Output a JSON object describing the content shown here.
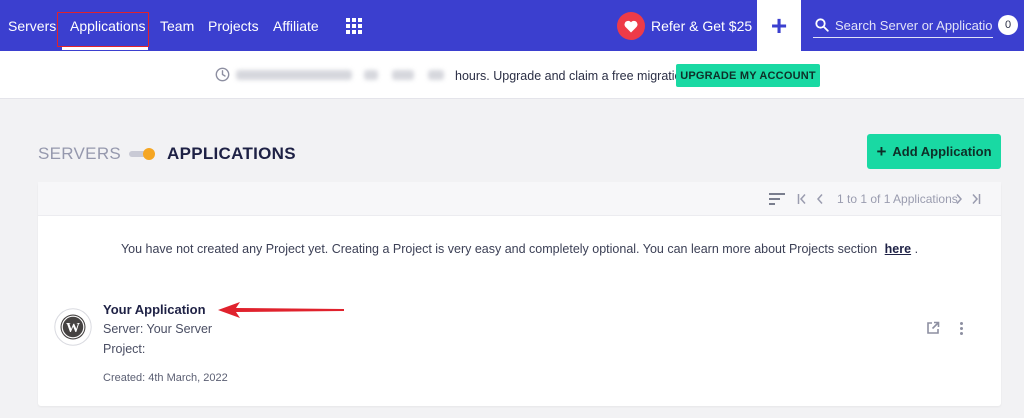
{
  "nav": {
    "items": [
      {
        "label": "Servers"
      },
      {
        "label": "Applications"
      },
      {
        "label": "Team"
      },
      {
        "label": "Projects"
      },
      {
        "label": "Affiliate"
      }
    ],
    "active": "Applications",
    "refer_label": "Refer & Get $25",
    "search_placeholder": "Search Server or Application",
    "notification_count": "0",
    "icons": [
      "apps-grid-icon",
      "heart-icon",
      "plus-icon",
      "search-icon"
    ],
    "colors": {
      "nav_bg": "#3b3fcf",
      "highlight_box": "#e0222d",
      "heart_badge": "#ee3b48"
    }
  },
  "banner": {
    "message": "hours. Upgrade and claim a free migration",
    "button_label": "UPGRADE MY ACCOUNT",
    "icon": "clock-icon",
    "accent_color": "#19d9a3"
  },
  "page": {
    "servers_label": "SERVERS",
    "applications_label": "APPLICATIONS",
    "add_button_label": "Add Application"
  },
  "list": {
    "pagination_text": "1 to 1 of 1 Applications",
    "info_text": "You have not created any Project yet. Creating a Project is very easy and completely optional. You can learn more about Projects section",
    "info_link": "here",
    "info_suffix": ".",
    "applications": [
      {
        "name": "Your Application",
        "server": "Server: Your Server",
        "project": "Project:",
        "created": "Created: 4th March, 2022",
        "icon": "wordpress-icon"
      }
    ],
    "annotation_color": "#e0222d"
  }
}
